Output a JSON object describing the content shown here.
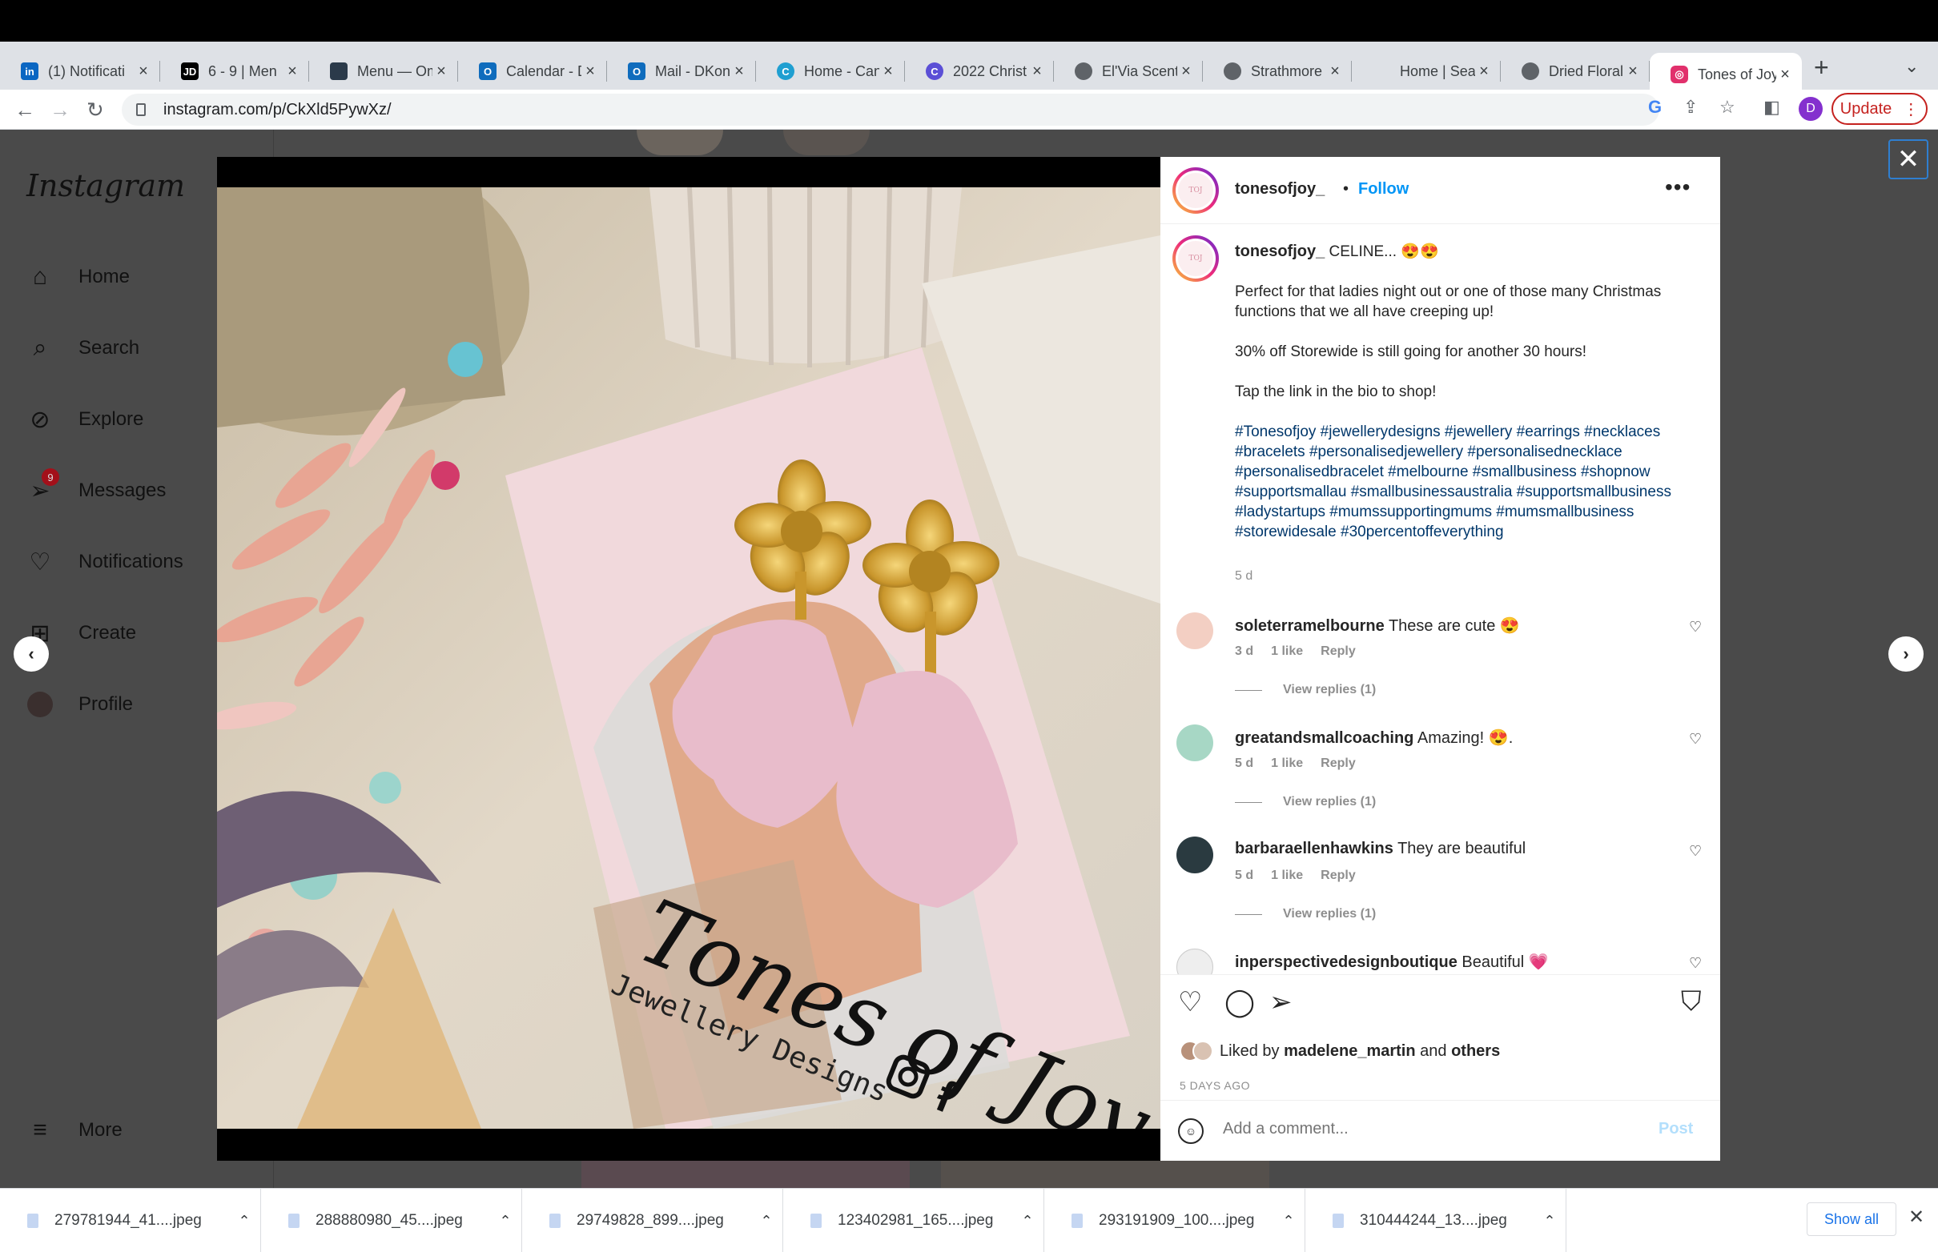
{
  "browser": {
    "tabs": [
      {
        "label": "(1) Notificati",
        "icon": "linkedin-icon",
        "color": "#0a66c2",
        "glyph": "in"
      },
      {
        "label": "6 - 9 | Men",
        "icon": "jd-icon",
        "color": "#000000",
        "glyph": "JD"
      },
      {
        "label": "Menu — Om",
        "icon": "menu-site-icon",
        "color": "#2b3a4a",
        "glyph": ""
      },
      {
        "label": "Calendar - D",
        "icon": "outlook-icon",
        "color": "#0f6cbd",
        "glyph": "O"
      },
      {
        "label": "Mail - DKon",
        "icon": "outlook-icon",
        "color": "#0f6cbd",
        "glyph": "O"
      },
      {
        "label": "Home - Can",
        "icon": "canva-icon",
        "color": "#1f9fd1",
        "glyph": "C"
      },
      {
        "label": "2022 Christ",
        "icon": "canva-icon",
        "color": "#5b4fd6",
        "glyph": "C"
      },
      {
        "label": "El'Via Scent",
        "icon": "globe-icon",
        "color": "#5f6368",
        "glyph": ""
      },
      {
        "label": "Strathmore",
        "icon": "globe-icon",
        "color": "#5f6368",
        "glyph": ""
      },
      {
        "label": "Home | Sear",
        "icon": "blank-icon",
        "color": "#dee1e6",
        "glyph": ""
      },
      {
        "label": "Dried Floral",
        "icon": "globe-icon",
        "color": "#5f6368",
        "glyph": ""
      },
      {
        "label": "Tones of Joy",
        "icon": "instagram-icon",
        "color": "#e1306c",
        "glyph": "◎"
      }
    ],
    "url": "instagram.com/p/CkXld5PywXz/",
    "profile_initial": "D",
    "update_label": "Update"
  },
  "instagram": {
    "logo": "Instagram",
    "nav": [
      {
        "label": "Home",
        "icon": "home-icon"
      },
      {
        "label": "Search",
        "icon": "search-icon"
      },
      {
        "label": "Explore",
        "icon": "explore-icon"
      },
      {
        "label": "Messages",
        "icon": "messages-icon",
        "badge": "9"
      },
      {
        "label": "Notifications",
        "icon": "heart-icon"
      },
      {
        "label": "Create",
        "icon": "create-icon"
      },
      {
        "label": "Profile",
        "icon": "profile-avatar-icon"
      },
      {
        "label": "More",
        "icon": "hamburger-icon"
      }
    ]
  },
  "post": {
    "username": "tonesofjoy_",
    "follow_label": "Follow",
    "caption_title": "CELINE... 😍😍",
    "caption_lines": [
      "Perfect for that ladies night out or one of those many Christmas functions that we all have creeping up!",
      "30% off Storewide is still going for another 30 hours!",
      "Tap the link in the bio to shop!"
    ],
    "hashtags": "#Tonesofjoy #jewellerydesigns #jewellery #earrings #necklaces #bracelets #personalisedjewellery #personalisednecklace #personalisedbracelet #melbourne #smallbusiness #shopnow #supportsmallau #smallbusinessaustralia #supportsmallbusiness #ladystartups #mumssupportingmums #mumsmallbusiness #storewidesale #30percentoffeverything",
    "caption_age": "5 d",
    "comments": [
      {
        "user": "soleterramelbourne",
        "text": "These are cute 😍",
        "age": "3 d",
        "likes": "1 like",
        "reply": "Reply",
        "replies": "View replies (1)",
        "avatar_color": "#f3cfc3"
      },
      {
        "user": "greatandsmallcoaching",
        "text": "Amazing! 😍.",
        "age": "5 d",
        "likes": "1 like",
        "reply": "Reply",
        "replies": "View replies (1)",
        "avatar_color": "#a7d7c5"
      },
      {
        "user": "barbaraellenhawkins",
        "text": "They are beautiful",
        "age": "5 d",
        "likes": "1 like",
        "reply": "Reply",
        "replies": "View replies (1)",
        "avatar_color": "#2a3a40"
      },
      {
        "user": "inperspectivedesignboutique",
        "text": "Beautiful 💗",
        "age": "",
        "likes": "",
        "reply": "",
        "replies": "",
        "avatar_color": "#eeeeee"
      }
    ],
    "liked_by_prefix": "Liked by",
    "liked_by_user": "madelene_martin",
    "liked_by_and": "and",
    "liked_by_others": "others",
    "posted_ago": "5 DAYS AGO",
    "comment_placeholder": "Add a comment...",
    "post_label": "Post",
    "photo": {
      "card_text_1": "Tones of Joy",
      "card_text_2": "Jewellery Designs"
    }
  },
  "downloads": {
    "files": [
      "279781944_41....jpeg",
      "288880980_45....jpeg",
      "29749828_899....jpeg",
      "123402981_165....jpeg",
      "293191909_100....jpeg",
      "310444244_13....jpeg"
    ],
    "show_all": "Show all"
  }
}
